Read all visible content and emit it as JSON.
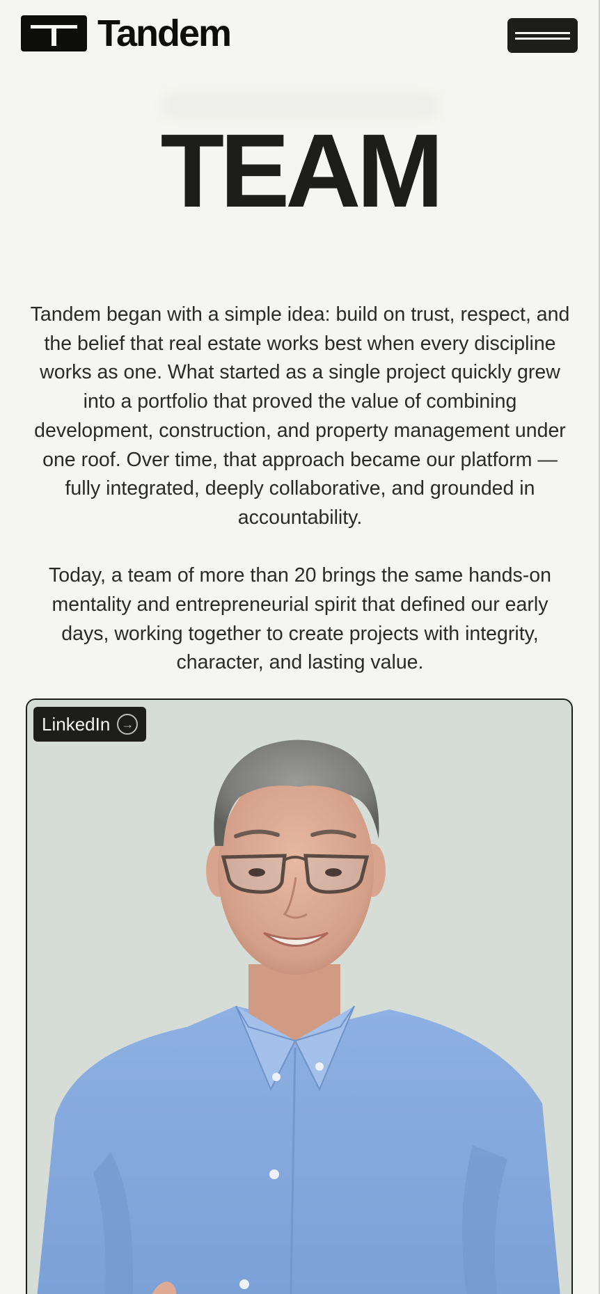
{
  "header": {
    "brand": "Tandem",
    "logo_icon": "tandem-t-logo",
    "menu_icon": "hamburger-menu-icon"
  },
  "main": {
    "title": "TEAM",
    "paragraphs": [
      "Tandem began with a simple idea: build on trust, respect, and the belief that real estate works best when every discipline works as one. What started as a single project quickly grew into a portfolio that proved the value of combining development, construction, and property management under one roof. Over time, that approach became our platform — fully integrated, deeply collaborative, and grounded in accountability.",
      "Today, a team of more than 20 brings the same hands-on mentality and entrepreneurial spirit that defined our early days, working together to create projects with integrity, character, and lasting value."
    ]
  },
  "team_card": {
    "linkedin_label": "LinkedIn",
    "linkedin_icon": "arrow-circle-right-icon"
  },
  "colors": {
    "background": "#f5f6f1",
    "ink": "#1d1d1b",
    "card_background": "#d6ddd7",
    "shirt": "#8fb0e0"
  }
}
